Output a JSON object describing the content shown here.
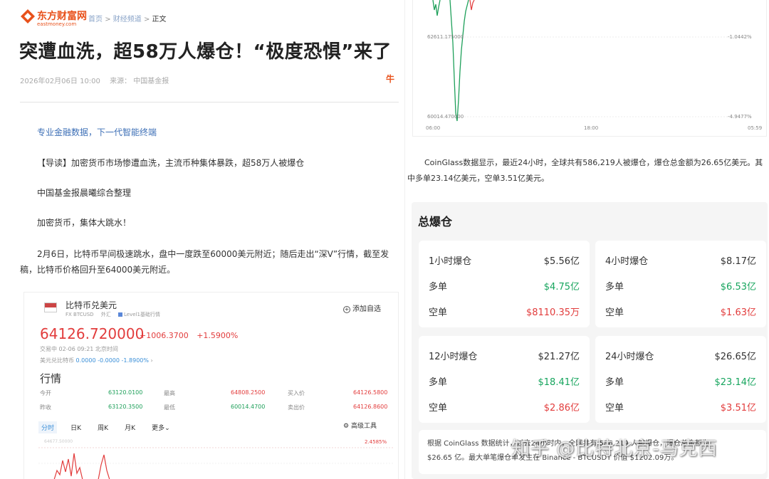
{
  "article": {
    "logo_cn": "东方财富网",
    "logo_en": "eastmoney.com",
    "breadcrumb": [
      "首页",
      "财经频道",
      "正文"
    ],
    "breadcrumb_sep": ">",
    "title": "突遭血洗，超58万人爆仓！“极度恐惧”来了",
    "date": "2026年02月06日 10:00",
    "source": "来源：  中国基金报",
    "promo": "专业金融数据，下一代智能终端",
    "paragraphs": [
      "【导读】加密货币市场惨遭血洗，主流币种集体暴跌，超58万人被爆仓",
      "中国基金报晨曦综合整理",
      "加密货币，集体大跳水！",
      "2月6日，比特币早间极速跳水，盘中一度跌至60000美元附近；随后走出“深V”行情，截至发稿，比特币价格回升至64000美元附近。"
    ]
  },
  "quote": {
    "name": "比特币兑美元",
    "tags": [
      "FX BTCUSD",
      "外汇",
      "Level1基础行情"
    ],
    "watch_label": "添加自选",
    "price": "64126.720000",
    "change": "+1006.3700",
    "change_pct": "+1.5900%",
    "time": "交易中 02-06 09:21 北京时间",
    "related_label": "美元兑比特币",
    "related_value": "0.0000  -0.0000  -1.8900%",
    "section": "行情",
    "fields": [
      {
        "label": "今开",
        "value": "63120.0100",
        "color": "#1ea05a"
      },
      {
        "label": "最高",
        "value": "64808.2500",
        "color": "#e23c3c"
      },
      {
        "label": "买入价",
        "value": "64126.5800",
        "color": "#e23c3c"
      },
      {
        "label": "昨收",
        "value": "63120.3500",
        "color": "#1ea05a"
      },
      {
        "label": "最低",
        "value": "60014.4700",
        "color": "#1ea05a"
      },
      {
        "label": "卖出价",
        "value": "64126.8600",
        "color": "#e23c3c"
      }
    ],
    "tabs": [
      "分时",
      "日K",
      "周K",
      "月K",
      "更多"
    ],
    "active_tab": 0,
    "adv_tools": "高级工具",
    "tick_left": "64677.50000",
    "tick_right": "2.4585%"
  },
  "top_chart": {
    "x_labels": [
      "06:00",
      "18:00",
      "05:59"
    ],
    "y_left_top": "62611.175000",
    "y_left_bottom": "60014.470000",
    "y_right_top": "-1.0442%",
    "y_right_bottom": "-4.9477%"
  },
  "coinglass_text": "CoinGlass数据显示，最近24小时，全球共有586,219人被爆仓，爆仓总金额为26.65亿美元。其中多单23.14亿美元，空单3.51亿美元。",
  "liquidations": {
    "title": "总爆仓",
    "cards": [
      {
        "period": "1小时爆仓",
        "total": "$5.56亿",
        "long_label": "多单",
        "long": "$4.75亿",
        "short_label": "空单",
        "short": "$8110.35万"
      },
      {
        "period": "4小时爆仓",
        "total": "$8.17亿",
        "long_label": "多单",
        "long": "$6.53亿",
        "short_label": "空单",
        "short": "$1.63亿"
      },
      {
        "period": "12小时爆仓",
        "total": "$21.27亿",
        "long_label": "多单",
        "long": "$18.41亿",
        "short_label": "空单",
        "short": "$2.86亿"
      },
      {
        "period": "24小时爆仓",
        "total": "$26.65亿",
        "long_label": "多单",
        "long": "$23.14亿",
        "short_label": "空单",
        "short": "$3.51亿"
      }
    ],
    "footnote_1": "根据 CoinGlass 数据统计，过去24小时内，全网共有 586,219 人被爆仓，爆仓总金额为",
    "footnote_2": "$26.65 亿。最大单笔爆仓单发生在 Binance - BTCUSDT 价值 $1202.09万。"
  },
  "watermark": "知乎 @比特北京-马克西",
  "colors": {
    "brand": "#e8511b",
    "up": "#e23c3c",
    "down": "#17a55e",
    "link": "#3d6fb6"
  }
}
